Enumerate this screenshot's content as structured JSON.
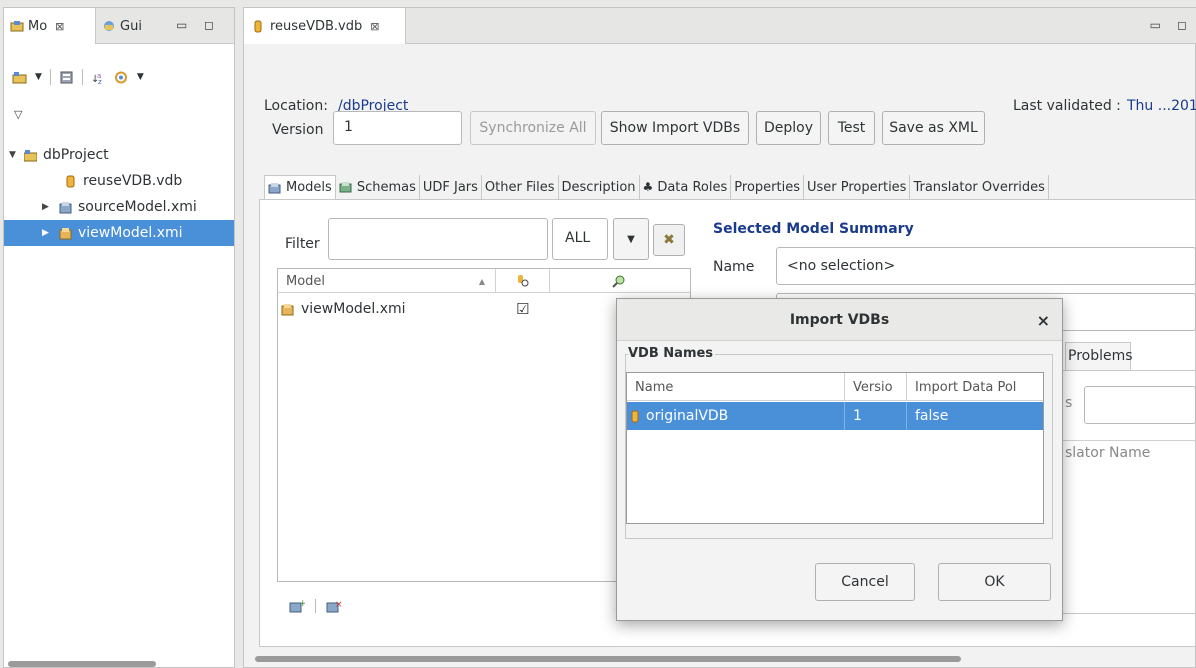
{
  "left_view": {
    "tab_model_label": "Mo",
    "tab_guides_label": "Gui",
    "close_glyph": "⊠",
    "minimize_glyph": "▭",
    "maximize_glyph": "◻",
    "view_menu_glyph": "▽",
    "tree": [
      {
        "label": "dbProject",
        "icon": "project-icon",
        "expanded": true
      },
      {
        "label": "reuseVDB.vdb",
        "icon": "vdb-icon"
      },
      {
        "label": "sourceModel.xmi",
        "icon": "source-model-icon"
      },
      {
        "label": "viewModel.xmi",
        "icon": "view-model-icon",
        "selected": true
      }
    ]
  },
  "editor": {
    "tab_label": "reuseVDB.vdb",
    "location_label": "Location:",
    "location_value": "/dbProject",
    "last_validated_label": "Last validated :",
    "last_validated_value": "Thu ...201",
    "version_label": "Version",
    "version_value": "1",
    "buttons": {
      "synchronize_all": "Synchronize All",
      "show_import_vdbs": "Show Import VDBs",
      "deploy": "Deploy",
      "test": "Test",
      "save_as_xml": "Save as XML"
    },
    "sub_tabs": [
      "Models",
      "Schemas",
      "UDF Jars",
      "Other Files",
      "Description",
      "Data Roles",
      "Properties",
      "User Properties",
      "Translator Overrides"
    ],
    "filter_label": "Filter",
    "filter_value": "",
    "filter_scope": "ALL",
    "model_table": {
      "columns": [
        "Model",
        "",
        ""
      ],
      "rows": [
        {
          "name": "viewModel.xmi",
          "checked": "☑"
        }
      ]
    },
    "summary": {
      "title": "Selected Model Summary",
      "name_label": "Name",
      "name_value": "<no selection>",
      "problems_tab": "Problems",
      "partial_label": "s",
      "translator_header": "slator Name"
    }
  },
  "dialog": {
    "title": "Import VDBs",
    "close_glyph": "×",
    "group_label": "VDB Names",
    "columns": [
      "Name",
      "Versio",
      "Import Data Pol"
    ],
    "rows": [
      {
        "name": "originalVDB",
        "version": "1",
        "import_data_policies": "false"
      }
    ],
    "cancel_label": "Cancel",
    "ok_label": "OK"
  },
  "colors": {
    "selection": "#4a90d9",
    "link_blue": "#1a3b8c"
  }
}
